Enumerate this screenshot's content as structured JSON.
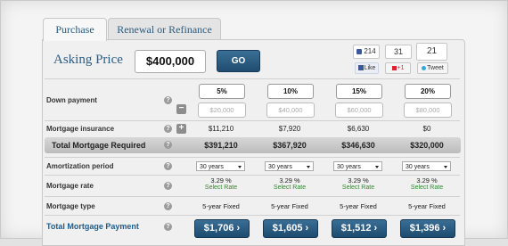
{
  "tabs": [
    {
      "label": "Purchase",
      "active": true
    },
    {
      "label": "Renewal or Refinance",
      "active": false
    }
  ],
  "asking_price": {
    "label": "Asking Price",
    "value": "$400,000",
    "go_label": "GO"
  },
  "social": {
    "facebook": {
      "count": "214",
      "like_label": "Like"
    },
    "googleplus": {
      "count": "31",
      "label": "+1"
    },
    "twitter": {
      "count": "21",
      "label": "Tweet"
    }
  },
  "rows": {
    "down_payment": "Down payment",
    "mortgage_insurance": "Mortgage insurance",
    "total_mortgage_required": "Total Mortgage Required",
    "amortization_period": "Amortization period",
    "mortgage_rate": "Mortgage rate",
    "mortgage_type": "Mortgage type",
    "total_mortgage_payment": "Total Mortgage Payment"
  },
  "help_symbol": "?",
  "minus_symbol": "−",
  "plus_symbol": "+",
  "columns": [
    {
      "down_pct": "5%",
      "down_amount": "$20,000",
      "insurance": "$11,210",
      "total_required": "$391,210",
      "amortization": "30 years",
      "rate": "3.29 %",
      "select_rate": "Select Rate",
      "type": "5-year Fixed",
      "payment": "$1,706"
    },
    {
      "down_pct": "10%",
      "down_amount": "$40,000",
      "insurance": "$7,920",
      "total_required": "$367,920",
      "amortization": "30 years",
      "rate": "3.29 %",
      "select_rate": "Select Rate",
      "type": "5-year Fixed",
      "payment": "$1,605"
    },
    {
      "down_pct": "15%",
      "down_amount": "$60,000",
      "insurance": "$6,630",
      "total_required": "$346,630",
      "amortization": "30 years",
      "rate": "3.29 %",
      "select_rate": "Select Rate",
      "type": "5-year Fixed",
      "payment": "$1,512"
    },
    {
      "down_pct": "20%",
      "down_amount": "$80,000",
      "insurance": "$0",
      "total_required": "$320,000",
      "amortization": "30 years",
      "rate": "3.29 %",
      "select_rate": "Select Rate",
      "type": "5-year Fixed",
      "payment": "$1,396"
    }
  ],
  "payment_chevron": "›",
  "colors": {
    "brand_blue": "#2c5c80",
    "button_blue": "#1f4c70",
    "select_rate_green": "#2f8a2f"
  }
}
